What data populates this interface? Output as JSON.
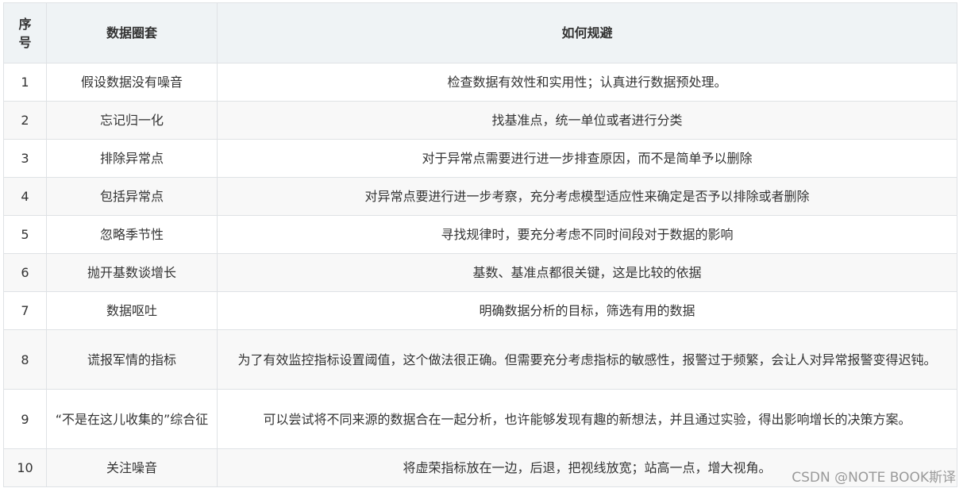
{
  "table": {
    "headers": {
      "index": "序号",
      "trap": "数据圈套",
      "avoid": "如何规避"
    },
    "rows": [
      {
        "index": "1",
        "trap": "假设数据没有噪音",
        "avoid": "检查数据有效性和实用性；认真进行数据预处理。"
      },
      {
        "index": "2",
        "trap": "忘记归一化",
        "avoid": "找基准点，统一单位或者进行分类"
      },
      {
        "index": "3",
        "trap": "排除异常点",
        "avoid": "对于异常点需要进行进一步排查原因，而不是简单予以删除"
      },
      {
        "index": "4",
        "trap": "包括异常点",
        "avoid": "对异常点要进行进一步考察，充分考虑模型适应性来确定是否予以排除或者删除"
      },
      {
        "index": "5",
        "trap": "忽略季节性",
        "avoid": "寻找规律时，要充分考虑不同时间段对于数据的影响"
      },
      {
        "index": "6",
        "trap": "抛开基数谈增长",
        "avoid": "基数、基准点都很关键，这是比较的依据"
      },
      {
        "index": "7",
        "trap": "数据呕吐",
        "avoid": "明确数据分析的目标，筛选有用的数据"
      },
      {
        "index": "8",
        "trap": "谎报军情的指标",
        "avoid": "为了有效监控指标设置阈值，这个做法很正确。但需要充分考虑指标的敏感性，报警过于频繁，会让人对异常报警变得迟钝。"
      },
      {
        "index": "9",
        "trap": "“不是在这儿收集的”综合征",
        "avoid": "可以尝试将不同来源的数据合在一起分析，也许能够发现有趣的新想法，并且通过实验，得出影响增长的决策方案。"
      },
      {
        "index": "10",
        "trap": "关注噪音",
        "avoid": "将虚荣指标放在一边，后退，把视线放宽；站高一点，增大视角。"
      }
    ]
  },
  "watermark": "CSDN @NOTE BOOK斯译"
}
